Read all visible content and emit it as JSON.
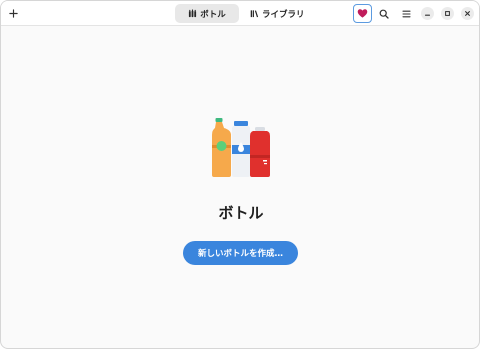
{
  "header": {
    "add_icon": "plus-icon",
    "tabs": [
      {
        "label": "ボトル",
        "icon": "bottle-icon",
        "active": true
      },
      {
        "label": "ライブラリ",
        "icon": "library-icon",
        "active": false
      }
    ],
    "donate_icon": "heart-icon",
    "search_icon": "search-icon",
    "menu_icon": "hamburger-menu-icon",
    "window_controls": [
      "minimize-icon",
      "maximize-icon",
      "close-icon"
    ]
  },
  "main": {
    "illustration": "bottles-illustration",
    "title": "ボトル",
    "create_button_label": "新しいボトルを作成…"
  },
  "colors": {
    "accent": "#3a85dd",
    "heart": "#c01c5b"
  }
}
